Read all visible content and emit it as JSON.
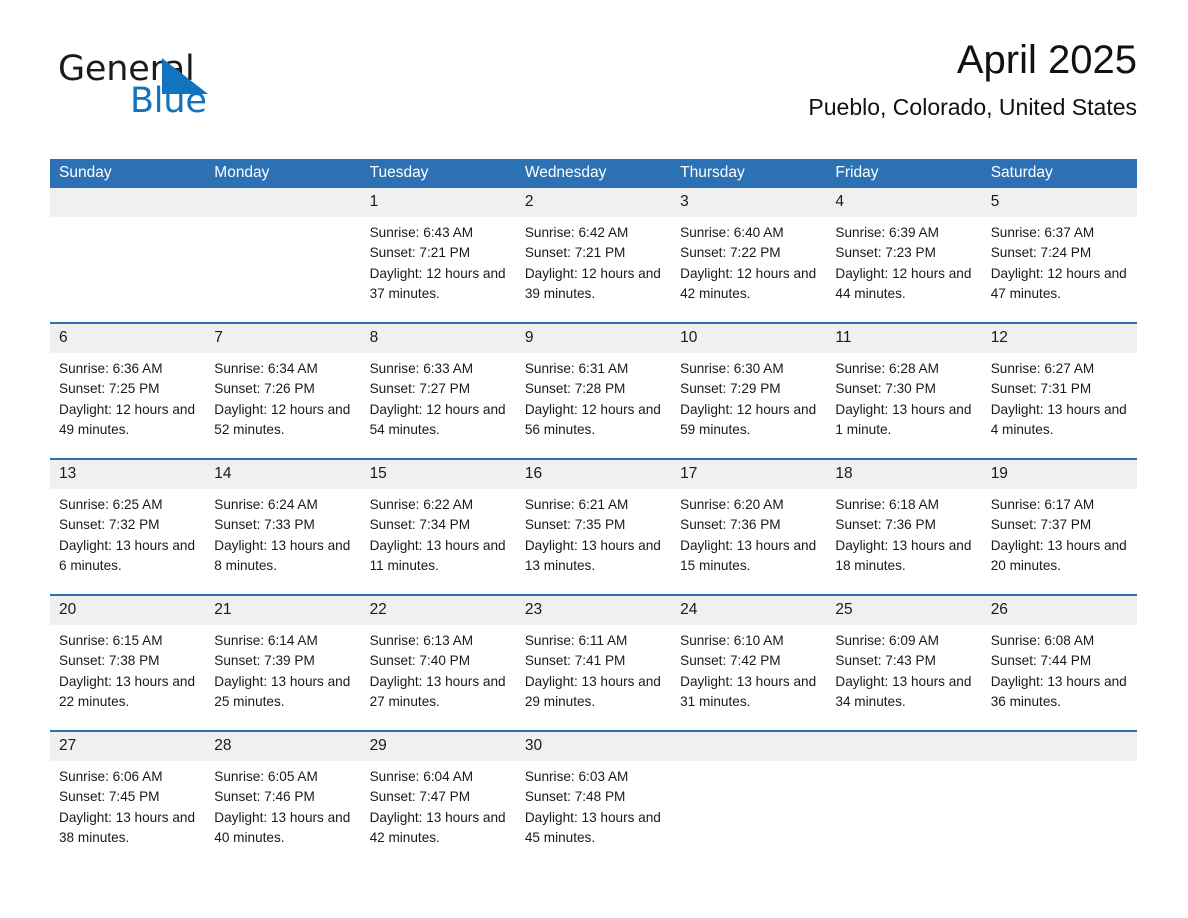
{
  "brand": {
    "name_part1": "General",
    "name_part2": "Blue",
    "triangle_color": "#1273be",
    "text_color": "#1b1b1b"
  },
  "header": {
    "title": "April 2025",
    "subtitle": "Pueblo, Colorado, United States"
  },
  "theme": {
    "header_blue": "#2d71b5",
    "daynum_band": "#f0f0f0",
    "page_background": "#ffffff"
  },
  "calendar": {
    "weekday_headers": [
      "Sunday",
      "Monday",
      "Tuesday",
      "Wednesday",
      "Thursday",
      "Friday",
      "Saturday"
    ],
    "weeks": [
      [
        {
          "day": "",
          "sunrise": "",
          "sunset": "",
          "daylight": ""
        },
        {
          "day": "",
          "sunrise": "",
          "sunset": "",
          "daylight": ""
        },
        {
          "day": "1",
          "sunrise": "Sunrise: 6:43 AM",
          "sunset": "Sunset: 7:21 PM",
          "daylight": "Daylight: 12 hours and 37 minutes."
        },
        {
          "day": "2",
          "sunrise": "Sunrise: 6:42 AM",
          "sunset": "Sunset: 7:21 PM",
          "daylight": "Daylight: 12 hours and 39 minutes."
        },
        {
          "day": "3",
          "sunrise": "Sunrise: 6:40 AM",
          "sunset": "Sunset: 7:22 PM",
          "daylight": "Daylight: 12 hours and 42 minutes."
        },
        {
          "day": "4",
          "sunrise": "Sunrise: 6:39 AM",
          "sunset": "Sunset: 7:23 PM",
          "daylight": "Daylight: 12 hours and 44 minutes."
        },
        {
          "day": "5",
          "sunrise": "Sunrise: 6:37 AM",
          "sunset": "Sunset: 7:24 PM",
          "daylight": "Daylight: 12 hours and 47 minutes."
        }
      ],
      [
        {
          "day": "6",
          "sunrise": "Sunrise: 6:36 AM",
          "sunset": "Sunset: 7:25 PM",
          "daylight": "Daylight: 12 hours and 49 minutes."
        },
        {
          "day": "7",
          "sunrise": "Sunrise: 6:34 AM",
          "sunset": "Sunset: 7:26 PM",
          "daylight": "Daylight: 12 hours and 52 minutes."
        },
        {
          "day": "8",
          "sunrise": "Sunrise: 6:33 AM",
          "sunset": "Sunset: 7:27 PM",
          "daylight": "Daylight: 12 hours and 54 minutes."
        },
        {
          "day": "9",
          "sunrise": "Sunrise: 6:31 AM",
          "sunset": "Sunset: 7:28 PM",
          "daylight": "Daylight: 12 hours and 56 minutes."
        },
        {
          "day": "10",
          "sunrise": "Sunrise: 6:30 AM",
          "sunset": "Sunset: 7:29 PM",
          "daylight": "Daylight: 12 hours and 59 minutes."
        },
        {
          "day": "11",
          "sunrise": "Sunrise: 6:28 AM",
          "sunset": "Sunset: 7:30 PM",
          "daylight": "Daylight: 13 hours and 1 minute."
        },
        {
          "day": "12",
          "sunrise": "Sunrise: 6:27 AM",
          "sunset": "Sunset: 7:31 PM",
          "daylight": "Daylight: 13 hours and 4 minutes."
        }
      ],
      [
        {
          "day": "13",
          "sunrise": "Sunrise: 6:25 AM",
          "sunset": "Sunset: 7:32 PM",
          "daylight": "Daylight: 13 hours and 6 minutes."
        },
        {
          "day": "14",
          "sunrise": "Sunrise: 6:24 AM",
          "sunset": "Sunset: 7:33 PM",
          "daylight": "Daylight: 13 hours and 8 minutes."
        },
        {
          "day": "15",
          "sunrise": "Sunrise: 6:22 AM",
          "sunset": "Sunset: 7:34 PM",
          "daylight": "Daylight: 13 hours and 11 minutes."
        },
        {
          "day": "16",
          "sunrise": "Sunrise: 6:21 AM",
          "sunset": "Sunset: 7:35 PM",
          "daylight": "Daylight: 13 hours and 13 minutes."
        },
        {
          "day": "17",
          "sunrise": "Sunrise: 6:20 AM",
          "sunset": "Sunset: 7:36 PM",
          "daylight": "Daylight: 13 hours and 15 minutes."
        },
        {
          "day": "18",
          "sunrise": "Sunrise: 6:18 AM",
          "sunset": "Sunset: 7:36 PM",
          "daylight": "Daylight: 13 hours and 18 minutes."
        },
        {
          "day": "19",
          "sunrise": "Sunrise: 6:17 AM",
          "sunset": "Sunset: 7:37 PM",
          "daylight": "Daylight: 13 hours and 20 minutes."
        }
      ],
      [
        {
          "day": "20",
          "sunrise": "Sunrise: 6:15 AM",
          "sunset": "Sunset: 7:38 PM",
          "daylight": "Daylight: 13 hours and 22 minutes."
        },
        {
          "day": "21",
          "sunrise": "Sunrise: 6:14 AM",
          "sunset": "Sunset: 7:39 PM",
          "daylight": "Daylight: 13 hours and 25 minutes."
        },
        {
          "day": "22",
          "sunrise": "Sunrise: 6:13 AM",
          "sunset": "Sunset: 7:40 PM",
          "daylight": "Daylight: 13 hours and 27 minutes."
        },
        {
          "day": "23",
          "sunrise": "Sunrise: 6:11 AM",
          "sunset": "Sunset: 7:41 PM",
          "daylight": "Daylight: 13 hours and 29 minutes."
        },
        {
          "day": "24",
          "sunrise": "Sunrise: 6:10 AM",
          "sunset": "Sunset: 7:42 PM",
          "daylight": "Daylight: 13 hours and 31 minutes."
        },
        {
          "day": "25",
          "sunrise": "Sunrise: 6:09 AM",
          "sunset": "Sunset: 7:43 PM",
          "daylight": "Daylight: 13 hours and 34 minutes."
        },
        {
          "day": "26",
          "sunrise": "Sunrise: 6:08 AM",
          "sunset": "Sunset: 7:44 PM",
          "daylight": "Daylight: 13 hours and 36 minutes."
        }
      ],
      [
        {
          "day": "27",
          "sunrise": "Sunrise: 6:06 AM",
          "sunset": "Sunset: 7:45 PM",
          "daylight": "Daylight: 13 hours and 38 minutes."
        },
        {
          "day": "28",
          "sunrise": "Sunrise: 6:05 AM",
          "sunset": "Sunset: 7:46 PM",
          "daylight": "Daylight: 13 hours and 40 minutes."
        },
        {
          "day": "29",
          "sunrise": "Sunrise: 6:04 AM",
          "sunset": "Sunset: 7:47 PM",
          "daylight": "Daylight: 13 hours and 42 minutes."
        },
        {
          "day": "30",
          "sunrise": "Sunrise: 6:03 AM",
          "sunset": "Sunset: 7:48 PM",
          "daylight": "Daylight: 13 hours and 45 minutes."
        },
        {
          "day": "",
          "sunrise": "",
          "sunset": "",
          "daylight": ""
        },
        {
          "day": "",
          "sunrise": "",
          "sunset": "",
          "daylight": ""
        },
        {
          "day": "",
          "sunrise": "",
          "sunset": "",
          "daylight": ""
        }
      ]
    ]
  }
}
